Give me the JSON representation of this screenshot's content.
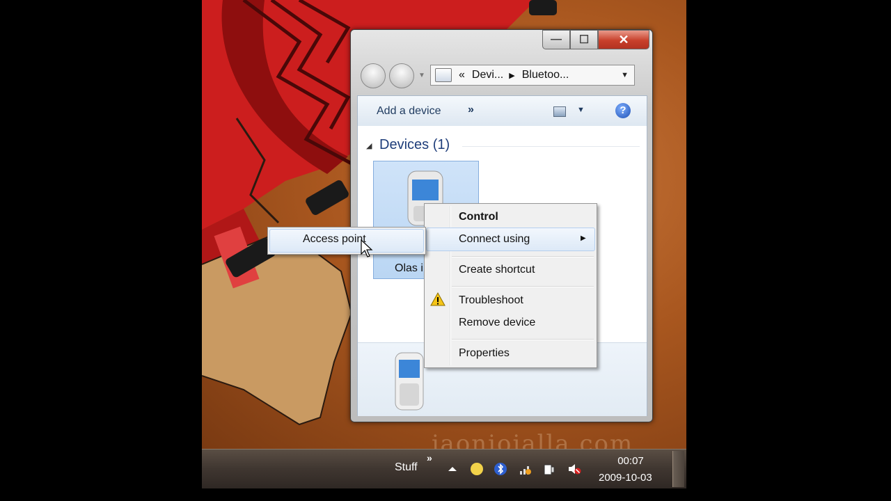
{
  "window": {
    "breadcrumb": [
      "Devi...",
      "Bluetoo..."
    ],
    "breadcrumb_prefix": "«",
    "close_label": "✕",
    "maximize_label": "☐",
    "minimize_label": "—"
  },
  "command_bar": {
    "add_device_label": "Add a device",
    "more_label": "»",
    "help_label": "?"
  },
  "devices_group": {
    "title": "Devices (1)",
    "device_label": "Olas i"
  },
  "context_menu": {
    "items": [
      {
        "label": "Control",
        "bold": true
      },
      {
        "label": "Connect using",
        "submenu": true
      },
      {
        "label": "Create shortcut"
      },
      {
        "label": "Troubleshoot",
        "icon": "warning-icon"
      },
      {
        "label": "Remove device"
      },
      {
        "label": "Properties"
      }
    ]
  },
  "submenu": {
    "items": [
      {
        "label": "Access point"
      }
    ]
  },
  "taskbar": {
    "toolbar_label": "Stuff",
    "chevron": "»",
    "time": "00:07",
    "date": "2009-10-03"
  },
  "wallpaper": {
    "watermark": "jaonioialla.com"
  },
  "colors": {
    "accent": "#1e3d7a",
    "close_button": "#c8402b",
    "menu_highlight": "#dde9f7"
  }
}
